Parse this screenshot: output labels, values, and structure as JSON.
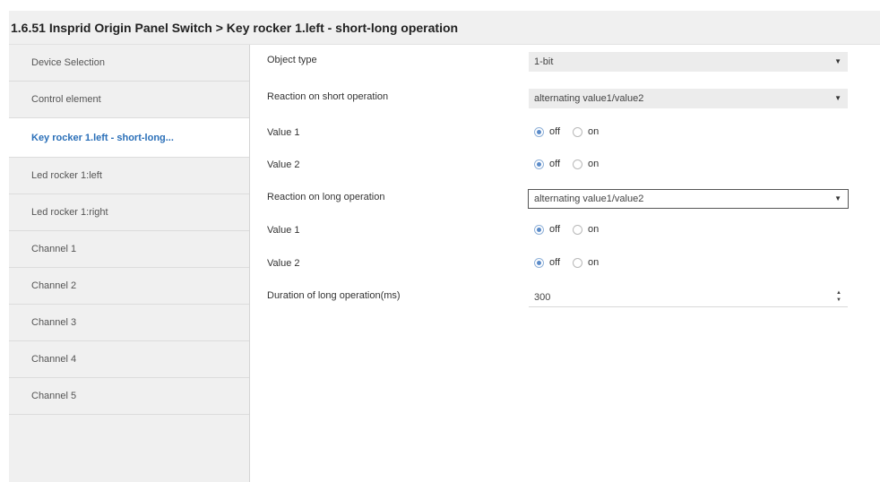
{
  "window": {
    "title": "1.6.51 Insprid Origin Panel Switch > Key rocker 1.left - short-long operation"
  },
  "sidebar": {
    "items": [
      {
        "label": "Device Selection",
        "active": false
      },
      {
        "label": "Control element",
        "active": false
      },
      {
        "label": "Key rocker 1.left - short-long...",
        "active": true
      },
      {
        "label": "Led rocker 1:left",
        "active": false
      },
      {
        "label": "Led rocker 1:right",
        "active": false
      },
      {
        "label": "Channel 1",
        "active": false
      },
      {
        "label": "Channel 2",
        "active": false
      },
      {
        "label": "Channel 3",
        "active": false
      },
      {
        "label": "Channel 4",
        "active": false
      },
      {
        "label": "Channel 5",
        "active": false
      }
    ]
  },
  "params": {
    "object_type": {
      "label": "Object type",
      "value": "1-bit"
    },
    "short_reaction": {
      "label": "Reaction on short operation",
      "value": "alternating value1/value2"
    },
    "short_value1": {
      "label": "Value 1",
      "off_label": "off",
      "on_label": "on",
      "selected": "off"
    },
    "short_value2": {
      "label": "Value 2",
      "off_label": "off",
      "on_label": "on",
      "selected": "off"
    },
    "long_reaction": {
      "label": "Reaction on long operation",
      "value": "alternating value1/value2"
    },
    "long_value1": {
      "label": "Value 1",
      "off_label": "off",
      "on_label": "on",
      "selected": "off"
    },
    "long_value2": {
      "label": "Value 2",
      "off_label": "off",
      "on_label": "on",
      "selected": "off"
    },
    "long_duration": {
      "label": "Duration of long operation(ms)",
      "value": "300"
    }
  },
  "icons": {
    "dropdown_arrow": "chevron-down-icon",
    "spin": "spinner-arrows-icon"
  },
  "colors": {
    "active_item_text": "#2a6fb8",
    "radio_checked": "#5a8bc9"
  }
}
